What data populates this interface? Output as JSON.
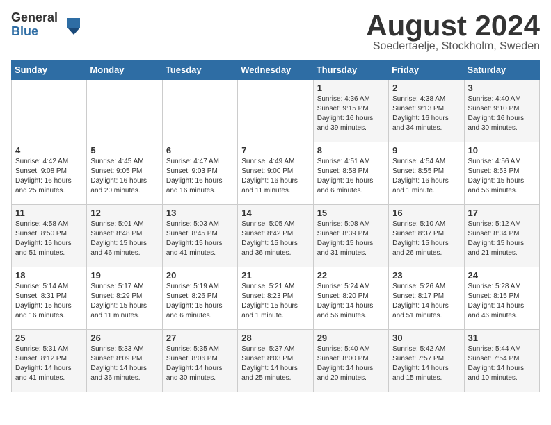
{
  "logo": {
    "general": "General",
    "blue": "Blue"
  },
  "title": "August 2024",
  "location": "Soedertaelje, Stockholm, Sweden",
  "days_of_week": [
    "Sunday",
    "Monday",
    "Tuesday",
    "Wednesday",
    "Thursday",
    "Friday",
    "Saturday"
  ],
  "weeks": [
    [
      {
        "day": "",
        "info": ""
      },
      {
        "day": "",
        "info": ""
      },
      {
        "day": "",
        "info": ""
      },
      {
        "day": "",
        "info": ""
      },
      {
        "day": "1",
        "info": "Sunrise: 4:36 AM\nSunset: 9:15 PM\nDaylight: 16 hours\nand 39 minutes."
      },
      {
        "day": "2",
        "info": "Sunrise: 4:38 AM\nSunset: 9:13 PM\nDaylight: 16 hours\nand 34 minutes."
      },
      {
        "day": "3",
        "info": "Sunrise: 4:40 AM\nSunset: 9:10 PM\nDaylight: 16 hours\nand 30 minutes."
      }
    ],
    [
      {
        "day": "4",
        "info": "Sunrise: 4:42 AM\nSunset: 9:08 PM\nDaylight: 16 hours\nand 25 minutes."
      },
      {
        "day": "5",
        "info": "Sunrise: 4:45 AM\nSunset: 9:05 PM\nDaylight: 16 hours\nand 20 minutes."
      },
      {
        "day": "6",
        "info": "Sunrise: 4:47 AM\nSunset: 9:03 PM\nDaylight: 16 hours\nand 16 minutes."
      },
      {
        "day": "7",
        "info": "Sunrise: 4:49 AM\nSunset: 9:00 PM\nDaylight: 16 hours\nand 11 minutes."
      },
      {
        "day": "8",
        "info": "Sunrise: 4:51 AM\nSunset: 8:58 PM\nDaylight: 16 hours\nand 6 minutes."
      },
      {
        "day": "9",
        "info": "Sunrise: 4:54 AM\nSunset: 8:55 PM\nDaylight: 16 hours\nand 1 minute."
      },
      {
        "day": "10",
        "info": "Sunrise: 4:56 AM\nSunset: 8:53 PM\nDaylight: 15 hours\nand 56 minutes."
      }
    ],
    [
      {
        "day": "11",
        "info": "Sunrise: 4:58 AM\nSunset: 8:50 PM\nDaylight: 15 hours\nand 51 minutes."
      },
      {
        "day": "12",
        "info": "Sunrise: 5:01 AM\nSunset: 8:48 PM\nDaylight: 15 hours\nand 46 minutes."
      },
      {
        "day": "13",
        "info": "Sunrise: 5:03 AM\nSunset: 8:45 PM\nDaylight: 15 hours\nand 41 minutes."
      },
      {
        "day": "14",
        "info": "Sunrise: 5:05 AM\nSunset: 8:42 PM\nDaylight: 15 hours\nand 36 minutes."
      },
      {
        "day": "15",
        "info": "Sunrise: 5:08 AM\nSunset: 8:39 PM\nDaylight: 15 hours\nand 31 minutes."
      },
      {
        "day": "16",
        "info": "Sunrise: 5:10 AM\nSunset: 8:37 PM\nDaylight: 15 hours\nand 26 minutes."
      },
      {
        "day": "17",
        "info": "Sunrise: 5:12 AM\nSunset: 8:34 PM\nDaylight: 15 hours\nand 21 minutes."
      }
    ],
    [
      {
        "day": "18",
        "info": "Sunrise: 5:14 AM\nSunset: 8:31 PM\nDaylight: 15 hours\nand 16 minutes."
      },
      {
        "day": "19",
        "info": "Sunrise: 5:17 AM\nSunset: 8:29 PM\nDaylight: 15 hours\nand 11 minutes."
      },
      {
        "day": "20",
        "info": "Sunrise: 5:19 AM\nSunset: 8:26 PM\nDaylight: 15 hours\nand 6 minutes."
      },
      {
        "day": "21",
        "info": "Sunrise: 5:21 AM\nSunset: 8:23 PM\nDaylight: 15 hours\nand 1 minute."
      },
      {
        "day": "22",
        "info": "Sunrise: 5:24 AM\nSunset: 8:20 PM\nDaylight: 14 hours\nand 56 minutes."
      },
      {
        "day": "23",
        "info": "Sunrise: 5:26 AM\nSunset: 8:17 PM\nDaylight: 14 hours\nand 51 minutes."
      },
      {
        "day": "24",
        "info": "Sunrise: 5:28 AM\nSunset: 8:15 PM\nDaylight: 14 hours\nand 46 minutes."
      }
    ],
    [
      {
        "day": "25",
        "info": "Sunrise: 5:31 AM\nSunset: 8:12 PM\nDaylight: 14 hours\nand 41 minutes."
      },
      {
        "day": "26",
        "info": "Sunrise: 5:33 AM\nSunset: 8:09 PM\nDaylight: 14 hours\nand 36 minutes."
      },
      {
        "day": "27",
        "info": "Sunrise: 5:35 AM\nSunset: 8:06 PM\nDaylight: 14 hours\nand 30 minutes."
      },
      {
        "day": "28",
        "info": "Sunrise: 5:37 AM\nSunset: 8:03 PM\nDaylight: 14 hours\nand 25 minutes."
      },
      {
        "day": "29",
        "info": "Sunrise: 5:40 AM\nSunset: 8:00 PM\nDaylight: 14 hours\nand 20 minutes."
      },
      {
        "day": "30",
        "info": "Sunrise: 5:42 AM\nSunset: 7:57 PM\nDaylight: 14 hours\nand 15 minutes."
      },
      {
        "day": "31",
        "info": "Sunrise: 5:44 AM\nSunset: 7:54 PM\nDaylight: 14 hours\nand 10 minutes."
      }
    ]
  ]
}
